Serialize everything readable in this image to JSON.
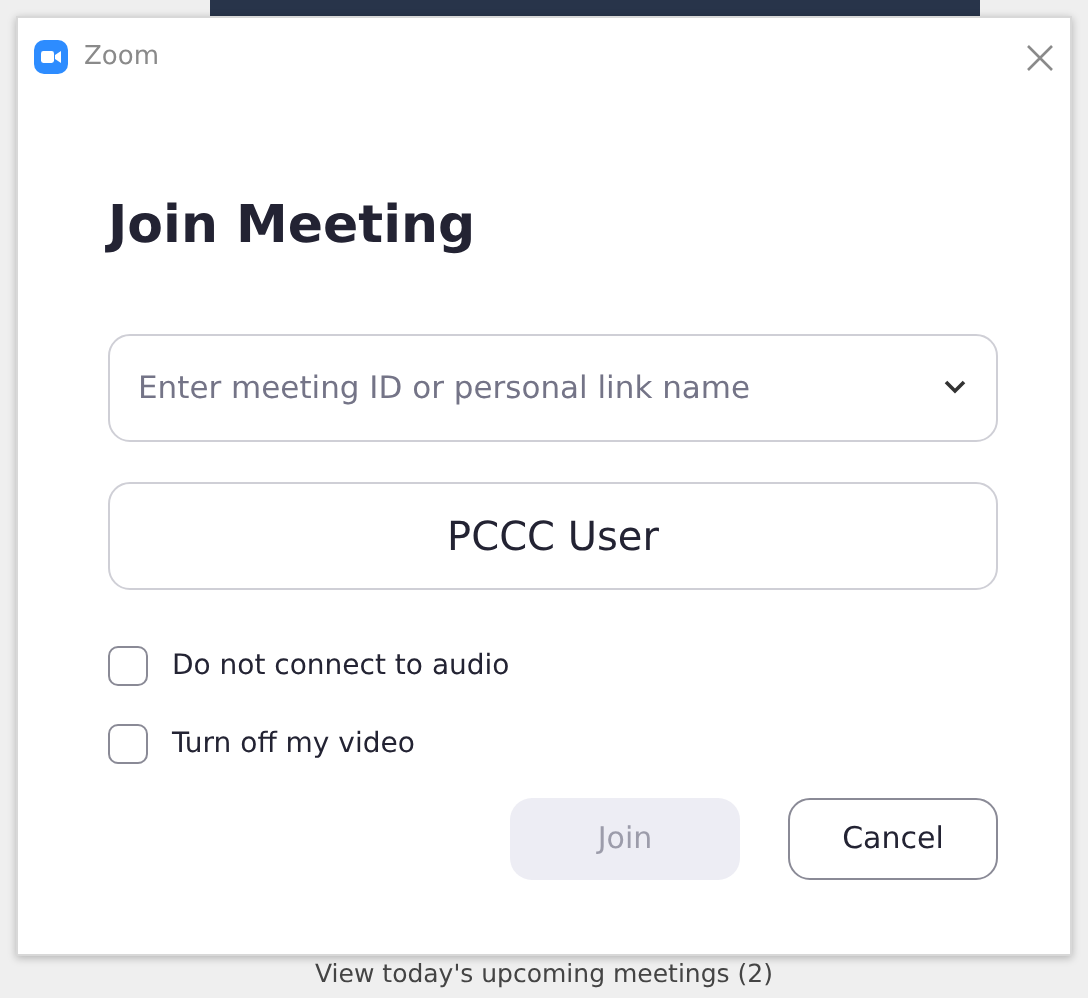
{
  "window": {
    "title": "Zoom"
  },
  "heading": "Join Meeting",
  "meeting_field": {
    "placeholder": "Enter meeting ID or personal link name"
  },
  "name_field": {
    "value": "PCCC User"
  },
  "options": [
    {
      "label": "Do not connect to audio",
      "checked": false
    },
    {
      "label": "Turn off my video",
      "checked": false
    }
  ],
  "buttons": [
    {
      "label": "Join",
      "disabled": true
    },
    {
      "label": "Cancel",
      "disabled": false
    }
  ],
  "background": {
    "link": "View today's upcoming meetings (2)"
  }
}
